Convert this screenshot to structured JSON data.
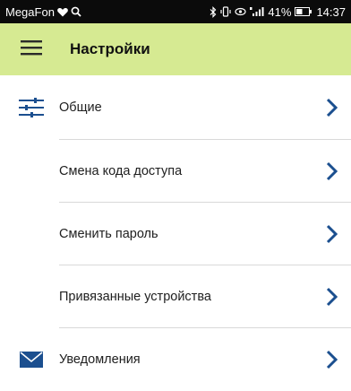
{
  "status_bar": {
    "carrier": "MegaFon",
    "battery": "41%",
    "time": "14:37"
  },
  "app_bar": {
    "title": "Настройки",
    "menu_icon": "hamburger-menu-icon",
    "background_color": "#d6ea92"
  },
  "settings_list": [
    {
      "label": "Общие",
      "icon": "sliders-icon"
    },
    {
      "label": "Смена кода доступа",
      "icon": ""
    },
    {
      "label": "Сменить пароль",
      "icon": ""
    },
    {
      "label": "Привязанные устройства",
      "icon": ""
    },
    {
      "label": "Уведомления",
      "icon": "envelope-icon"
    }
  ],
  "colors": {
    "accent_blue": "#1b4f8f",
    "divider": "#d9d9d9"
  }
}
